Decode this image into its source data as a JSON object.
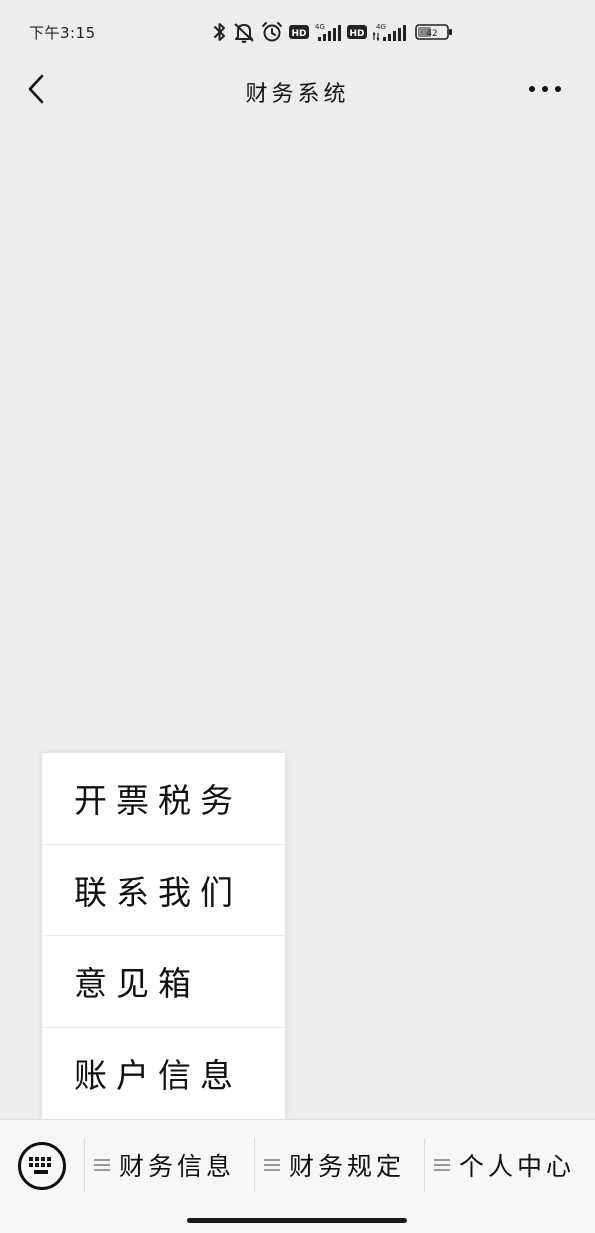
{
  "status_bar": {
    "time": "下午3:15",
    "hd1": "HD",
    "net1": "4G",
    "hd2": "HD",
    "net2": "4G",
    "battery": "42",
    "icons": [
      "bluetooth-icon",
      "bell-off-icon",
      "alarm-icon",
      "hd-icon",
      "signal-icon",
      "hd-icon",
      "signal-icon",
      "battery-icon"
    ]
  },
  "nav": {
    "title": "财务系统",
    "back_icon": "chevron-left-icon",
    "more_icon": "more-dots-icon"
  },
  "popup_menu": {
    "items": [
      {
        "label": "开票税务"
      },
      {
        "label": "联系我们"
      },
      {
        "label": "意见箱"
      },
      {
        "label": "账户信息"
      }
    ]
  },
  "bottom_menu": {
    "keyboard_icon": "keyboard-icon",
    "tabs": [
      {
        "label": "财务信息",
        "icon": "menu-lines-icon"
      },
      {
        "label": "财务规定",
        "icon": "menu-lines-icon"
      },
      {
        "label": "个人中心",
        "icon": "menu-lines-icon"
      }
    ]
  }
}
